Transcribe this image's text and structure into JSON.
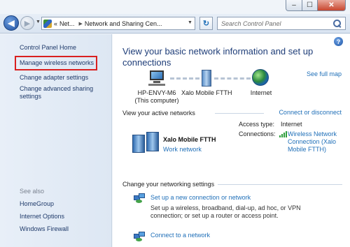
{
  "window": {
    "controls": {
      "minimize": "–",
      "maximize": "☐",
      "close": "✕"
    }
  },
  "address_bar": {
    "back": "◀",
    "forward": "▶",
    "crumbs": [
      "«",
      "Net...",
      "Network and Sharing Cen..."
    ],
    "refresh": "↻",
    "search_placeholder": "Search Control Panel"
  },
  "left_pane": {
    "home": "Control Panel Home",
    "links": [
      "Manage wireless networks",
      "Change adapter settings",
      "Change advanced sharing settings"
    ],
    "highlighted_link_index": 0,
    "highlight_color": "#d92020",
    "see_also_heading": "See also",
    "see_also": [
      "HomeGroup",
      "Internet Options",
      "Windows Firewall"
    ]
  },
  "main": {
    "help": "?",
    "title": "View your basic network information and set up connections",
    "see_full_map": "See full map",
    "map_nodes": [
      {
        "label_line1": "HP-ENVY-M6",
        "label_line2": "(This computer)",
        "icon": "computer-icon"
      },
      {
        "label_line1": "Xalo Mobile FTTH",
        "label_line2": "",
        "icon": "network-icon"
      },
      {
        "label_line1": "Internet",
        "label_line2": "",
        "icon": "globe-icon"
      }
    ],
    "active_heading": "View your active networks",
    "connect_disconnect": "Connect or disconnect",
    "active_network": {
      "name": "Xalo Mobile FTTH",
      "type": "Work network",
      "access_type_label": "Access type:",
      "access_type_value": "Internet",
      "connections_label": "Connections:",
      "connection_value": "Wireless Network Connection (Xalo Mobile FTTH)"
    },
    "settings_heading": "Change your networking settings",
    "tasks": [
      {
        "title": "Set up a new connection or network",
        "description": "Set up a wireless, broadband, dial-up, ad hoc, or VPN connection; or set up a router or access point."
      },
      {
        "title": "Connect to a network",
        "description": ""
      }
    ]
  }
}
